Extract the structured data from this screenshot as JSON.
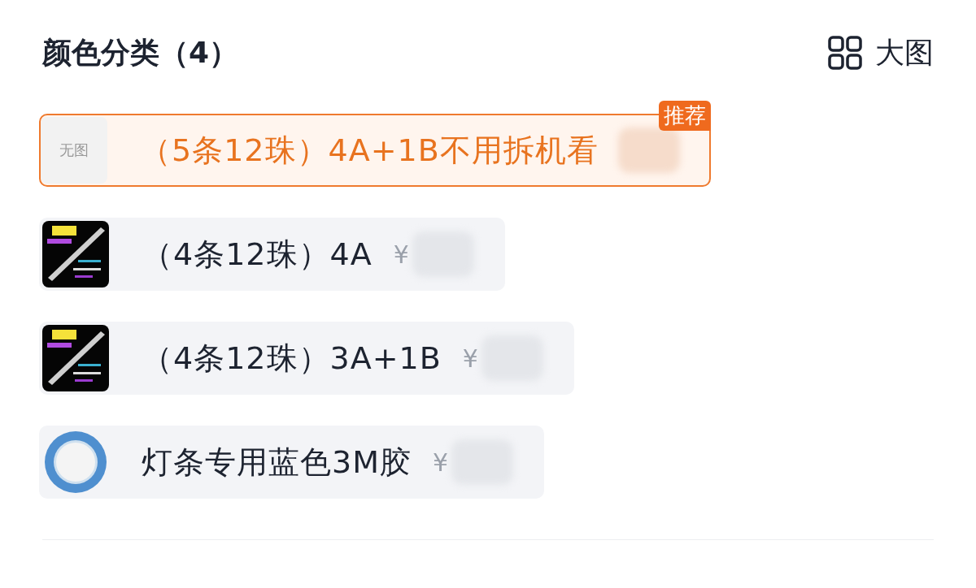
{
  "header": {
    "title": "颜色分类（4）",
    "view_toggle": "大图"
  },
  "options": [
    {
      "label": "（5条12珠）4A+1B不用拆机看",
      "selected": true,
      "badge": "推荐",
      "thumb": {
        "kind": "none",
        "text": "无图"
      }
    },
    {
      "label": "（4条12珠）4A",
      "selected": false,
      "thumb": {
        "kind": "strip"
      },
      "currency": "¥"
    },
    {
      "label": "（4条12珠）3A+1B",
      "selected": false,
      "thumb": {
        "kind": "strip"
      },
      "currency": "¥"
    },
    {
      "label": "灯条专用蓝色3M胶",
      "selected": false,
      "thumb": {
        "kind": "tape"
      },
      "currency": "¥"
    }
  ]
}
